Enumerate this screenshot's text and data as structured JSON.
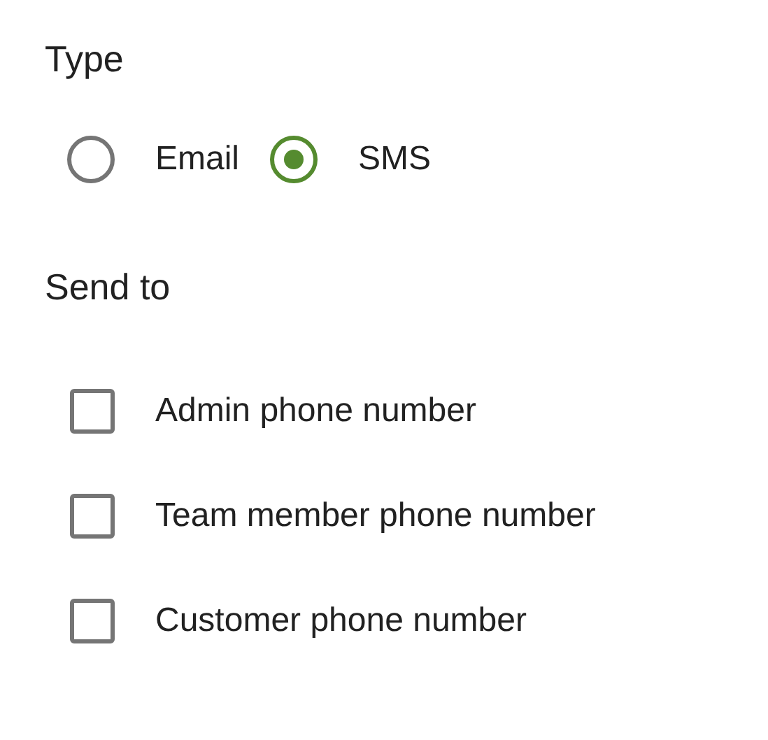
{
  "type_section": {
    "heading": "Type",
    "options": [
      {
        "label": "Email",
        "selected": false
      },
      {
        "label": "SMS",
        "selected": true
      }
    ]
  },
  "send_to_section": {
    "heading": "Send to",
    "options": [
      {
        "label": "Admin phone number",
        "checked": false
      },
      {
        "label": "Team member phone number",
        "checked": false
      },
      {
        "label": "Customer phone number",
        "checked": false
      }
    ]
  }
}
